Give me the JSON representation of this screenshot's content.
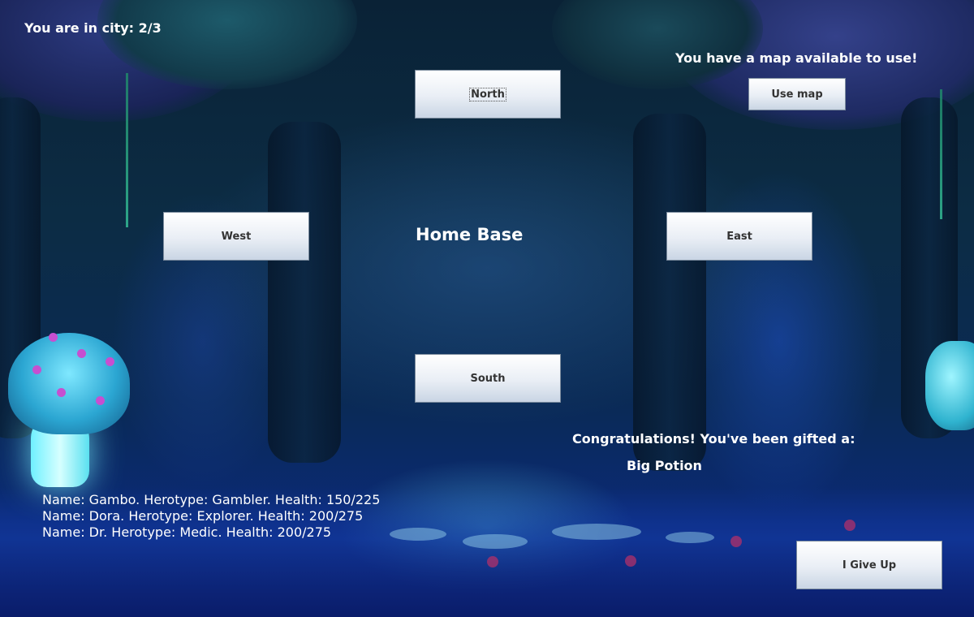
{
  "city_status": "You are in city: 2/3",
  "map_notice": "You have a map available to use!",
  "buttons": {
    "north": "North",
    "south": "South",
    "east": "East",
    "west": "West",
    "use_map": "Use map",
    "give_up": "I Give Up"
  },
  "location_title": "Home Base",
  "gift": {
    "message": "Congratulations! You've been gifted a:",
    "item": "Big Potion"
  },
  "party": [
    "Name: Gambo. Herotype: Gambler. Health: 150/225",
    "Name: Dora. Herotype: Explorer. Health: 200/275",
    "Name: Dr. Herotype: Medic. Health: 200/275"
  ],
  "colors": {
    "text": "#ffffff",
    "button_top": "#ffffff",
    "button_bottom": "#c9d5e4"
  }
}
